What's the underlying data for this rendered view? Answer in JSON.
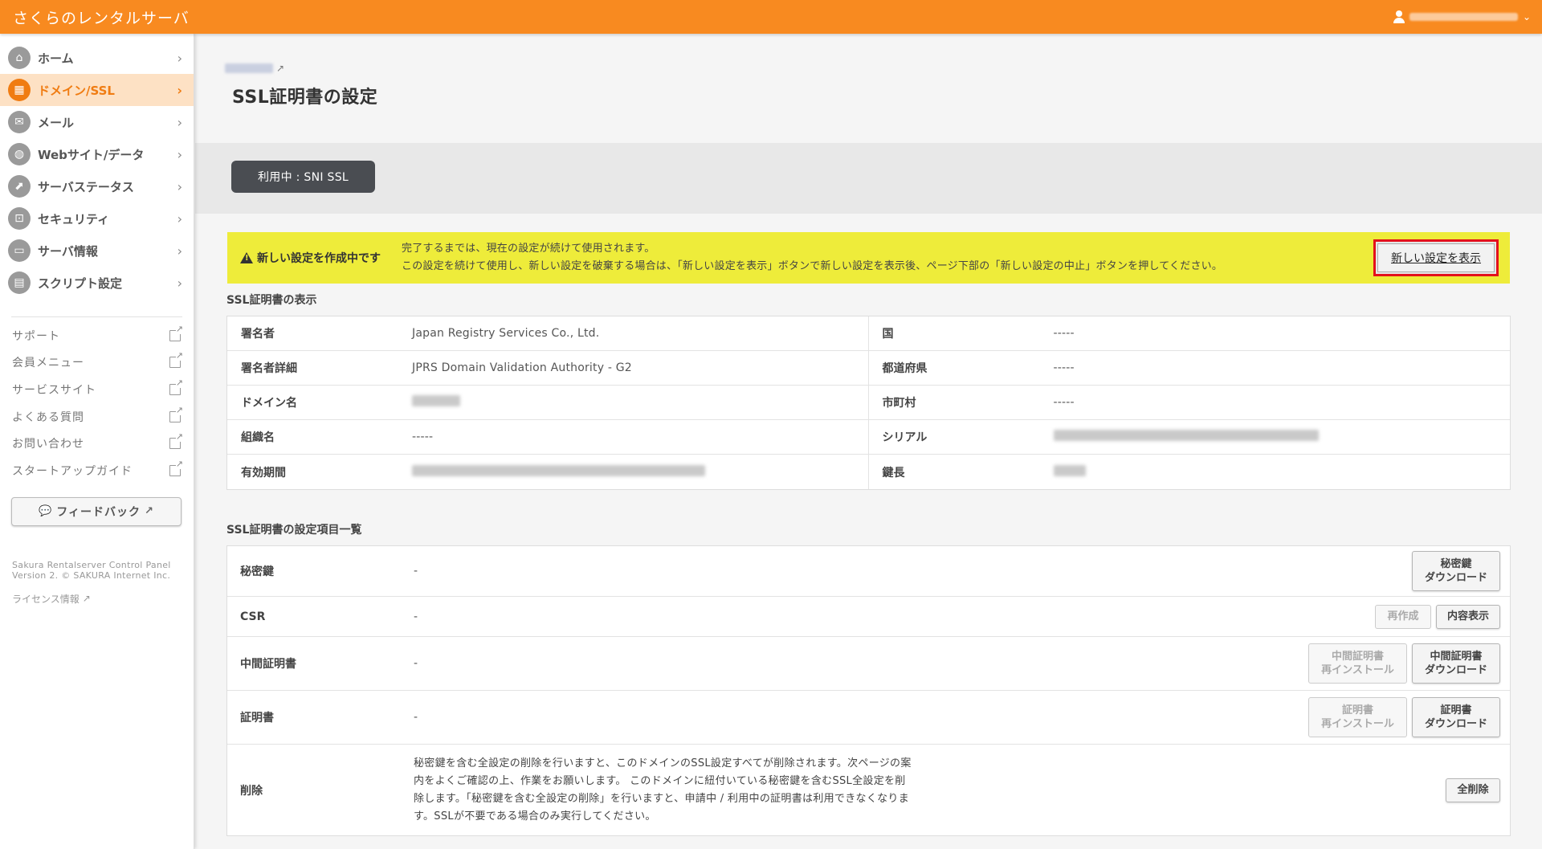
{
  "header": {
    "brand": "さくらのレンタルサーバ"
  },
  "sidebar": {
    "items": [
      {
        "label": "ホーム",
        "icon": "⌂"
      },
      {
        "label": "ドメイン/SSL",
        "icon": "▦"
      },
      {
        "label": "メール",
        "icon": "✉"
      },
      {
        "label": "Webサイト/データ",
        "icon": "◍"
      },
      {
        "label": "サーバステータス",
        "icon": "⬈"
      },
      {
        "label": "セキュリティ",
        "icon": "⊡"
      },
      {
        "label": "サーバ情報",
        "icon": "▭"
      },
      {
        "label": "スクリプト設定",
        "icon": "▤"
      }
    ],
    "links": [
      "サポート",
      "会員メニュー",
      "サービスサイト",
      "よくある質問",
      "お問い合わせ",
      "スタートアップガイド"
    ],
    "feedback": "フィードバック",
    "footer_line1": "Sakura Rentalserver Control Panel",
    "footer_line2": "Version 2. © SAKURA Internet Inc.",
    "license": "ライセンス情報"
  },
  "page": {
    "title": "SSL証明書の設定",
    "status": "利用中 : SNI SSL"
  },
  "alert": {
    "title": "新しい設定を作成中です",
    "line1": "完了するまでは、現在の設定が続けて使用されます。",
    "line2": "この設定を続けて使用し、新しい設定を破棄する場合は、「新しい設定を表示」ボタンで新しい設定を表示後、ページ下部の「新しい設定の中止」ボタンを押してください。",
    "button": "新しい設定を表示"
  },
  "cert": {
    "section_title": "SSL証明書の表示",
    "rows": [
      {
        "l1": "署名者",
        "v1": "Japan Registry Services Co., Ltd.",
        "l2": "国",
        "v2": "-----"
      },
      {
        "l1": "署名者詳細",
        "v1": "JPRS Domain Validation Authority - G2",
        "l2": "都道府県",
        "v2": "-----"
      },
      {
        "l1": "ドメイン名",
        "v1": "",
        "l2": "市町村",
        "v2": "-----"
      },
      {
        "l1": "組織名",
        "v1": "-----",
        "l2": "シリアル",
        "v2": ""
      },
      {
        "l1": "有効期間",
        "v1": "",
        "l2": "鍵長",
        "v2": ""
      }
    ]
  },
  "settings": {
    "section_title": "SSL証明書の設定項目一覧",
    "private_key": {
      "label": "秘密鍵",
      "value": "-",
      "download_l1": "秘密鍵",
      "download_l2": "ダウンロード"
    },
    "csr": {
      "label": "CSR",
      "value": "-",
      "recreate": "再作成",
      "view": "内容表示"
    },
    "intermediate": {
      "label": "中間証明書",
      "value": "-",
      "reinstall_l1": "中間証明書",
      "reinstall_l2": "再インストール",
      "download_l1": "中間証明書",
      "download_l2": "ダウンロード"
    },
    "certificate": {
      "label": "証明書",
      "value": "-",
      "reinstall_l1": "証明書",
      "reinstall_l2": "再インストール",
      "download_l1": "証明書",
      "download_l2": "ダウンロード"
    },
    "delete": {
      "label": "削除",
      "text": "秘密鍵を含む全設定の削除を行いますと、このドメインのSSL設定すべてが削除されます。次ページの案内をよくご確認の上、作業をお願いします。 このドメインに紐付いている秘密鍵を含むSSL全設定を削除します。「秘密鍵を含む全設定の削除」を行いますと、申請中 / 利用中の証明書は利用できなくなります。SSLが不要である場合のみ実行してください。",
      "button": "全削除"
    }
  },
  "colors": {
    "brand": "#f88a20",
    "active_bg": "#fde1c4",
    "alert_bg": "#eeec3a",
    "highlight": "#e4101c",
    "pill": "#4a4d52"
  }
}
